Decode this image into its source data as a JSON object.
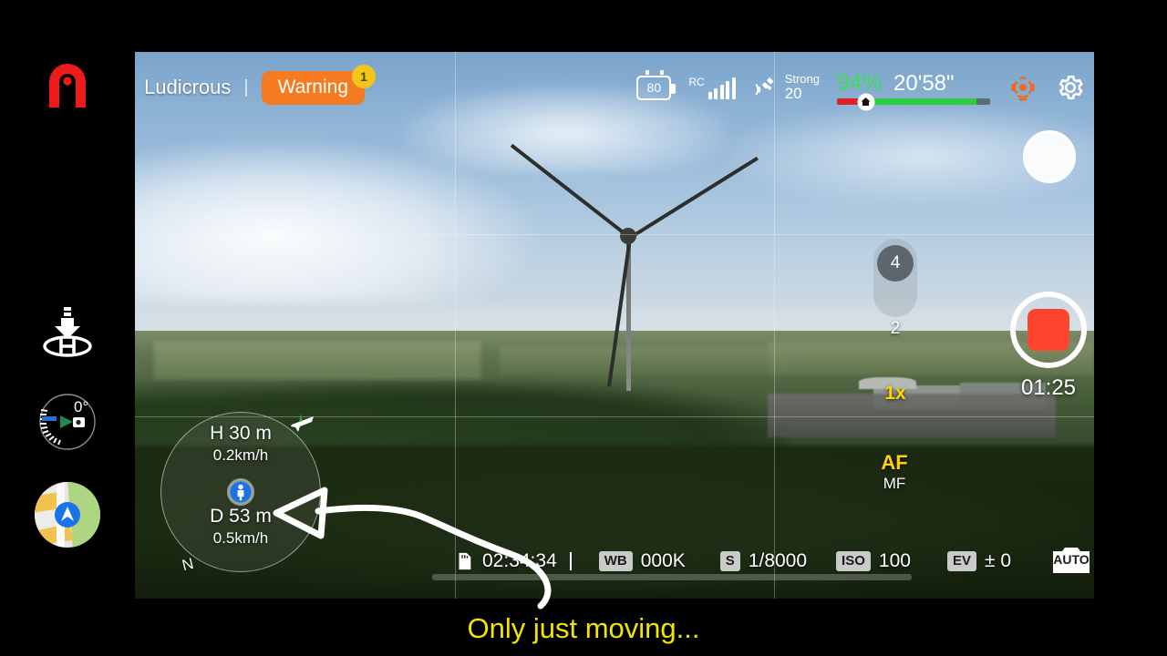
{
  "topbar": {
    "flight_mode": "Ludicrous",
    "divider": "|",
    "warning_label": "Warning",
    "warning_count": "1",
    "battery_icon_value": "80",
    "rc_label": "RC",
    "rc_bars": 5,
    "gps_strength": "Strong",
    "gps_satellites": "20",
    "battery_percent": "94%",
    "flight_time_remaining": "20'58\"",
    "sensing_icon": "obstacle-sensing-icon",
    "settings_icon": "gear-icon",
    "accent_warning": "#f47b20",
    "accent_battery_green": "#3ddc5a"
  },
  "rail": {
    "logo": "A",
    "rth_icon": "return-to-home-icon",
    "gimbal_value": "0°",
    "map_icon": "map-thumbnail-icon"
  },
  "compass": {
    "altitude_label": "H 30 m",
    "vertical_speed": "0.2km/h",
    "distance_label": "D 53 m",
    "horizontal_speed": "0.5km/h",
    "north_marker": "N",
    "aircraft_icon": "aircraft-icon",
    "home_icon": "home-point-icon"
  },
  "camera": {
    "photo_shutter_icon": "photo-shutter-button",
    "zoom_selected": "4",
    "zoom_option_2": "2",
    "zoom_level": "1x",
    "record_icon": "stop-record-icon",
    "record_timer": "01:25",
    "focus_af": "AF",
    "focus_mf": "MF",
    "focus_accent": "#ffd400"
  },
  "bottom_bar": {
    "sd_icon": "sd-card-icon",
    "record_capacity": "02:34:34",
    "wb_tag": "WB",
    "wb_value": "000K",
    "shutter_tag": "S",
    "shutter_value": "1/8000",
    "iso_tag": "ISO",
    "iso_value": "100",
    "ev_tag": "EV",
    "ev_value": "± 0",
    "mode_tag": "AUTO"
  },
  "annotation": {
    "caption": "Only just moving...",
    "caption_color": "#f2e500",
    "arrow": "curved-arrow-pointing-to-compass"
  }
}
